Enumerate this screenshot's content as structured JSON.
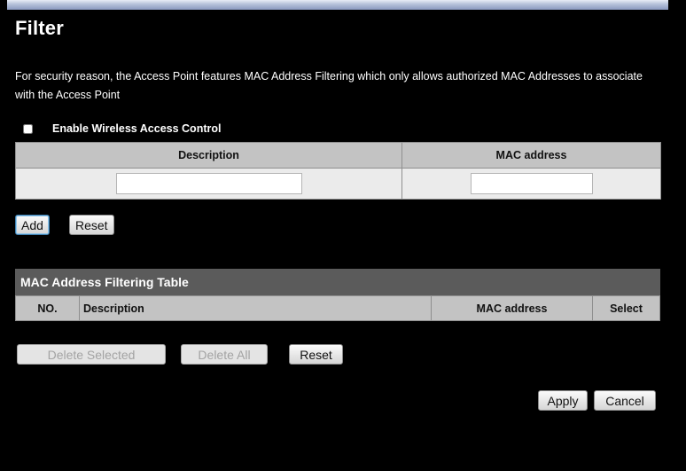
{
  "page": {
    "title": "Filter",
    "intro": "For security reason, the Access Point features MAC Address Filtering which only allows authorized MAC Addresses to associate with the Access Point"
  },
  "access_control": {
    "enable_label": "Enable Wireless Access Control",
    "enabled": false
  },
  "entry_form": {
    "columns": [
      "Description",
      "MAC address"
    ],
    "description_value": "",
    "mac_value": "",
    "add_label": "Add",
    "reset_label": "Reset"
  },
  "filter_table": {
    "title": "MAC Address Filtering Table",
    "columns": [
      "NO.",
      "Description",
      "MAC address",
      "Select"
    ],
    "rows": []
  },
  "table_actions": {
    "delete_selected_label": "Delete Selected",
    "delete_all_label": "Delete All",
    "reset_label": "Reset"
  },
  "footer_actions": {
    "apply_label": "Apply",
    "cancel_label": "Cancel"
  },
  "colors": {
    "background": "#000000",
    "header_bar": "#9aa8c9",
    "table_header": "#c3c3c3",
    "table_title": "#5b5b5b",
    "input_row": "#ebebeb"
  }
}
